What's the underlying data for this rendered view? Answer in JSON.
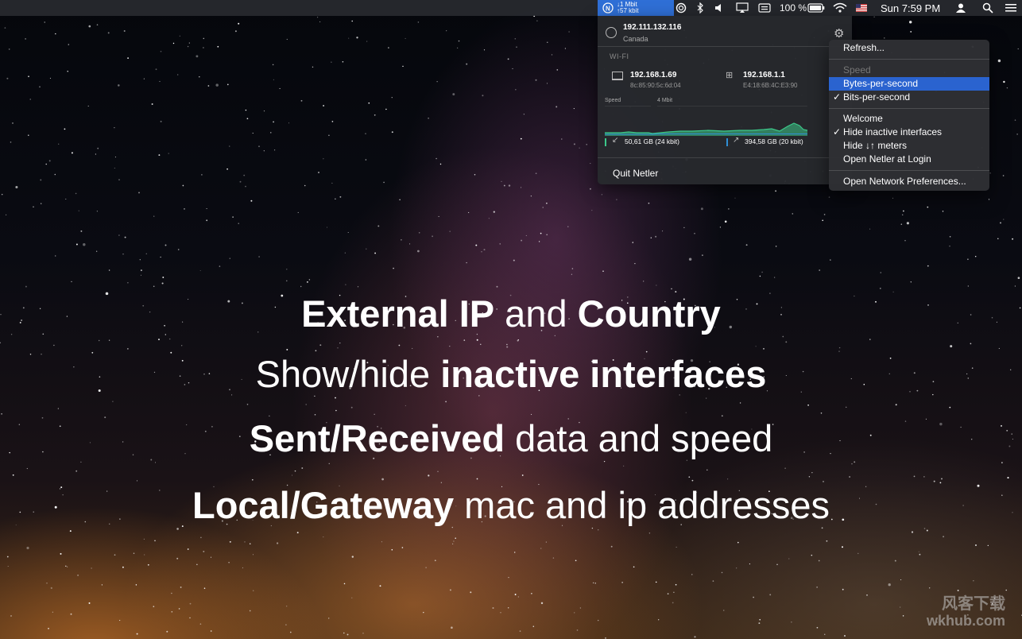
{
  "menubar": {
    "netler_down": "↓1 Mbit",
    "netler_up": "↑57 kbit",
    "battery": "100 %",
    "clock": "Sun 7:59 PM",
    "icons": [
      "netler-icon",
      "circle-icon",
      "bluetooth-icon",
      "volume-icon",
      "airplay-icon",
      "keyboard-icon",
      "battery-icon",
      "wifi-icon",
      "flag-us-icon",
      "user-icon",
      "spotlight-icon",
      "notification-icon"
    ]
  },
  "panel": {
    "external_ip": "192.111.132.116",
    "country": "Canada",
    "section": "WI-FI",
    "local_ip": "192.168.1.69",
    "local_mac": "8c:85:90:5c:6d:04",
    "gateway_ip": "192.168.1.1",
    "gateway_mac": "E4:18:6B:4C:E3:90",
    "speed_label": "Speed",
    "scale_label": "4 Mbit",
    "received": "50,61 GB (24 kbit)",
    "sent": "394,58 GB (20 kbit)",
    "quit": "Quit Netler"
  },
  "menu": {
    "refresh": "Refresh...",
    "speed_header": "Speed",
    "bytes": "Bytes-per-second",
    "bits": "Bits-per-second",
    "welcome": "Welcome",
    "hide_inactive": "Hide inactive interfaces",
    "hide_meters": "Hide ↓↑ meters",
    "open_login": "Open Netler at Login",
    "open_prefs": "Open Network Preferences...",
    "check": "✓"
  },
  "promo": {
    "line1_bold_a": "External IP",
    "line1_normal": " and ",
    "line1_bold_b": "Country",
    "line2_normal": "Show/hide ",
    "line2_bold": "inactive interfaces",
    "line3_bold": "Sent/Received",
    "line3_normal": " data and speed",
    "line4_bold": "Local/Gateway",
    "line4_normal": " mac and ip addresses"
  },
  "watermark": {
    "line1": "风客下载",
    "line2": "wkhub.com"
  },
  "colors": {
    "accent": "#2a63cf",
    "recv": "#3cc88a",
    "sent": "#2f8fd6"
  }
}
